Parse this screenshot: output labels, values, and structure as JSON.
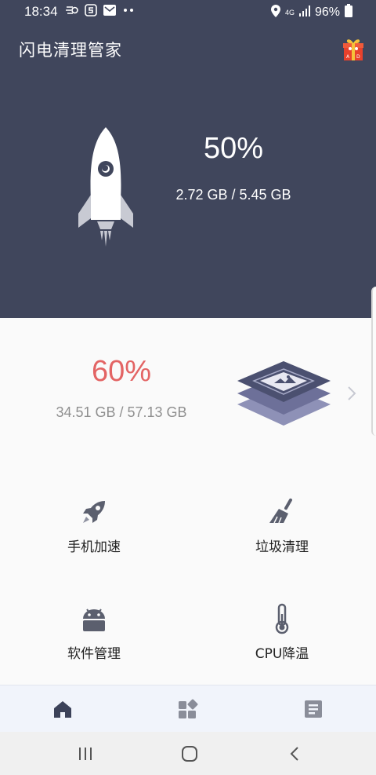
{
  "status_bar": {
    "time": "18:34",
    "battery": "96%",
    "network": "4G"
  },
  "header": {
    "app_title": "闪电清理管家"
  },
  "memory": {
    "percent": "50%",
    "detail": "2.72 GB / 5.45 GB"
  },
  "storage": {
    "percent": "60%",
    "detail": "34.51 GB / 57.13 GB"
  },
  "features": [
    {
      "label": "手机加速",
      "icon": "rocket-icon"
    },
    {
      "label": "垃圾清理",
      "icon": "broom-icon"
    },
    {
      "label": "软件管理",
      "icon": "android-icon"
    },
    {
      "label": "CPU降温",
      "icon": "thermometer-icon"
    }
  ],
  "bottom_nav": [
    {
      "icon": "home-icon",
      "active": true
    },
    {
      "icon": "apps-icon",
      "active": false
    },
    {
      "icon": "article-icon",
      "active": false
    }
  ],
  "colors": {
    "hero_bg": "#40465c",
    "accent_red": "#e36464",
    "icon_gray": "#5b5f6e",
    "nav_active": "#3c4259"
  }
}
